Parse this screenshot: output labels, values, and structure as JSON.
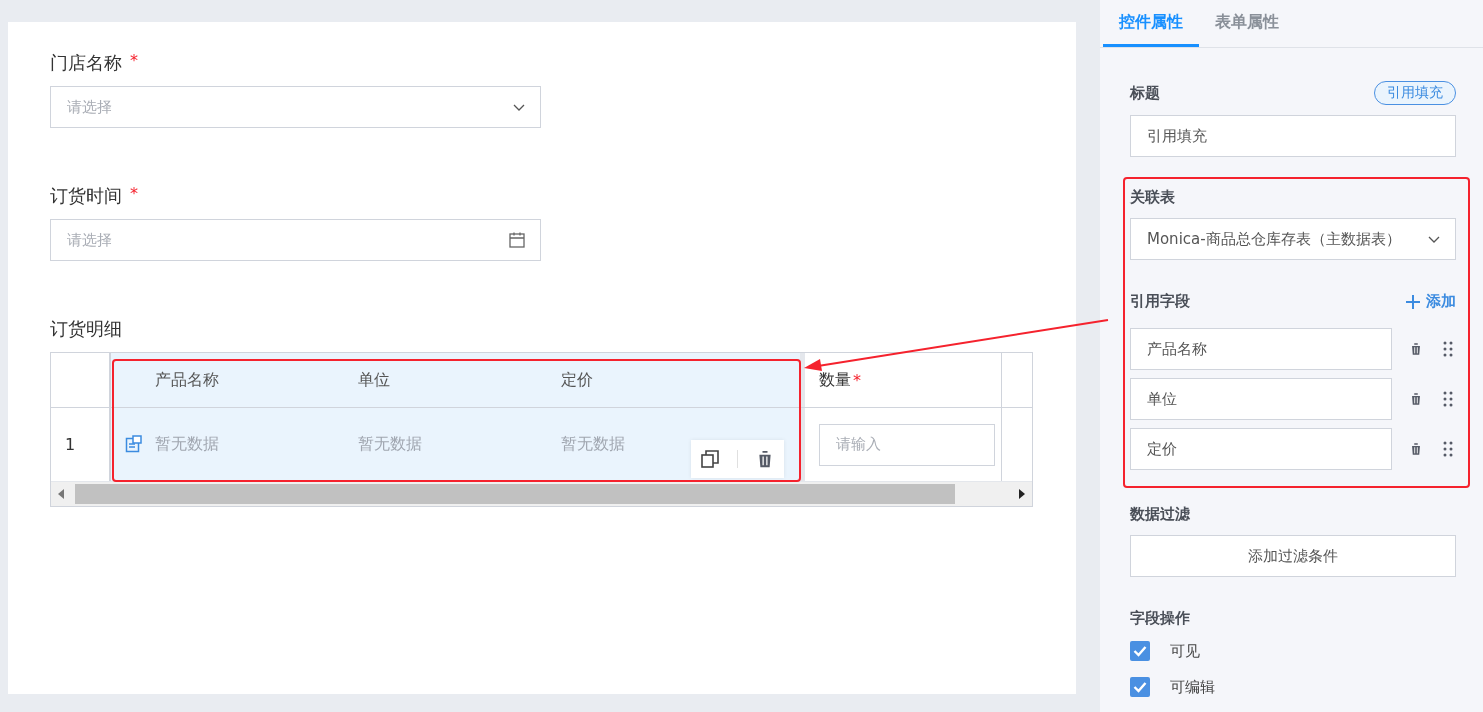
{
  "form": {
    "fields": [
      {
        "kind": "select",
        "label": "门店名称",
        "required_mark": "*",
        "placeholder": "请选择"
      },
      {
        "kind": "date",
        "label": "订货时间",
        "required_mark": "*",
        "placeholder": "请选择"
      }
    ],
    "detail": {
      "label": "订货明细",
      "columns": [
        "产品名称",
        "单位",
        "定价"
      ],
      "quantity_column": {
        "label": "数量",
        "required_mark": "*"
      },
      "rows": [
        {
          "index": "1",
          "cells": [
            "暂无数据",
            "暂无数据",
            "暂无数据"
          ],
          "quantity_placeholder": "请输入",
          "hovered": true
        }
      ]
    }
  },
  "panel": {
    "tabs": [
      {
        "label": "控件属性",
        "selected": true
      },
      {
        "label": "表单属性",
        "selected": false
      }
    ],
    "title": {
      "label": "标题",
      "badge": "引用填充",
      "value": "引用填充"
    },
    "related": {
      "label": "关联表",
      "value": "Monica-商品总仓库存表（主数据表）"
    },
    "ref": {
      "label": "引用字段",
      "add": "添加",
      "fields": [
        "产品名称",
        "单位",
        "定价"
      ]
    },
    "filter": {
      "label": "数据过滤",
      "button": "添加过滤条件"
    },
    "ops": {
      "label": "字段操作",
      "items": [
        {
          "label": "可见",
          "checked": true
        },
        {
          "label": "可编辑",
          "checked": true
        }
      ]
    }
  }
}
